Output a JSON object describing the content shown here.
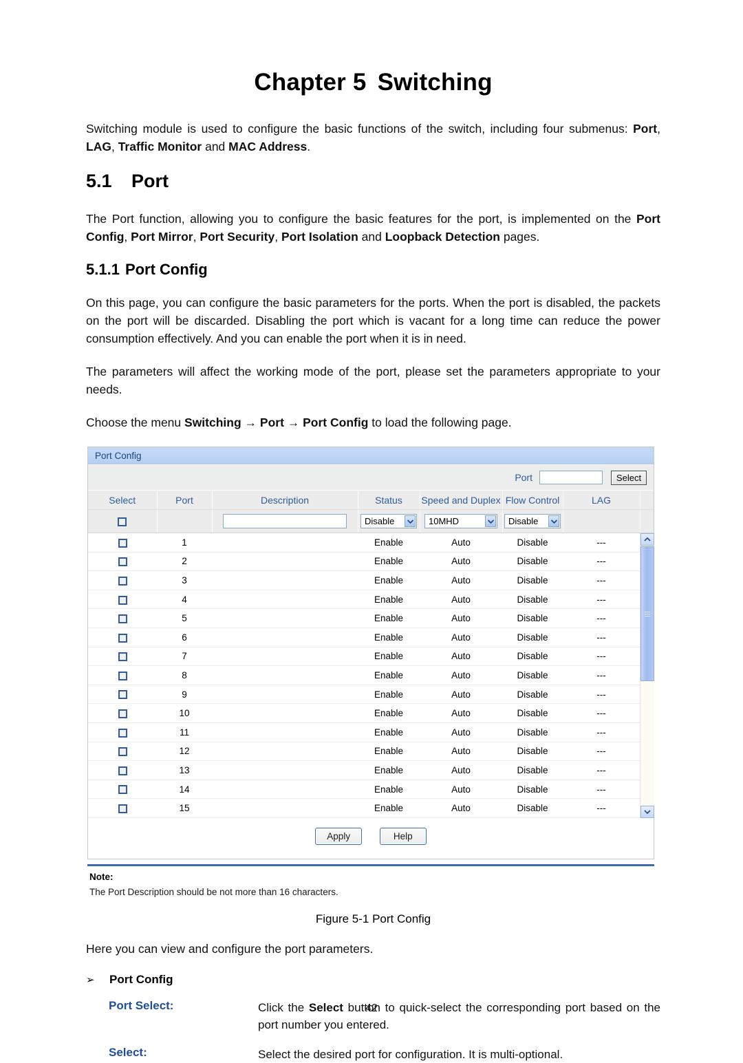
{
  "document": {
    "chapter_number": "Chapter 5",
    "chapter_title": "Switching",
    "intro_paragraph_part1": "Switching module is used to configure the basic functions of the switch, including four submenus: ",
    "intro_bold_1": "Port",
    "intro_sep_1": ", ",
    "intro_bold_2": "LAG",
    "intro_sep_2": ", ",
    "intro_bold_3": "Traffic Monitor",
    "intro_sep_3": " and ",
    "intro_bold_4": "MAC Address",
    "intro_end": ".",
    "section_number": "5.1",
    "section_title": "Port",
    "port_paragraph_part1": "The Port function, allowing you to configure the basic features for the port, is implemented on the ",
    "port_bold_1": "Port Config",
    "port_sep_1": ", ",
    "port_bold_2": "Port Mirror",
    "port_sep_2": ", ",
    "port_bold_3": "Port Security",
    "port_sep_3": ", ",
    "port_bold_4": "Port Isolation",
    "port_sep_4": " and ",
    "port_bold_5": "Loopback Detection",
    "port_end": " pages.",
    "subsection_number": "5.1.1",
    "subsection_title": "Port Config",
    "paragraph_2": "On this page, you can configure the basic parameters for the ports. When the port is disabled, the packets on the port will be discarded. Disabling the port which is vacant for a long time can reduce the power consumption effectively. And you can enable the port when it is in need.",
    "paragraph_3": "The parameters will affect the working mode of the port, please set the parameters appropriate to your needs.",
    "choose_menu_prefix": "Choose the menu ",
    "choose_menu_b1": "Switching",
    "choose_menu_arrow1": " → ",
    "choose_menu_b2": "Port",
    "choose_menu_arrow2": " → ",
    "choose_menu_b3": "Port Config",
    "choose_menu_suffix": " to load the following page.",
    "figure_caption": "Figure 5-1 Port Config",
    "after_figure_text": "Here you can view and configure the port parameters.",
    "bullet_marker": "➢",
    "bullet_heading": "Port Config",
    "page_number": "42"
  },
  "ui": {
    "panel_title": "Port Config",
    "search": {
      "label": "Port",
      "value": "",
      "placeholder": "",
      "select_button": "Select"
    },
    "table": {
      "headers": [
        "Select",
        "Port",
        "Description",
        "Status",
        "Speed and Duplex",
        "Flow Control",
        "LAG"
      ],
      "config_row": {
        "description_value": "",
        "description_placeholder": "",
        "status_value": "Disable",
        "speed_value": "10MHD",
        "flow_value": "Disable"
      },
      "rows": [
        {
          "port": "1",
          "description": "",
          "status": "Enable",
          "speed": "Auto",
          "flow": "Disable",
          "lag": "---"
        },
        {
          "port": "2",
          "description": "",
          "status": "Enable",
          "speed": "Auto",
          "flow": "Disable",
          "lag": "---"
        },
        {
          "port": "3",
          "description": "",
          "status": "Enable",
          "speed": "Auto",
          "flow": "Disable",
          "lag": "---"
        },
        {
          "port": "4",
          "description": "",
          "status": "Enable",
          "speed": "Auto",
          "flow": "Disable",
          "lag": "---"
        },
        {
          "port": "5",
          "description": "",
          "status": "Enable",
          "speed": "Auto",
          "flow": "Disable",
          "lag": "---"
        },
        {
          "port": "6",
          "description": "",
          "status": "Enable",
          "speed": "Auto",
          "flow": "Disable",
          "lag": "---"
        },
        {
          "port": "7",
          "description": "",
          "status": "Enable",
          "speed": "Auto",
          "flow": "Disable",
          "lag": "---"
        },
        {
          "port": "8",
          "description": "",
          "status": "Enable",
          "speed": "Auto",
          "flow": "Disable",
          "lag": "---"
        },
        {
          "port": "9",
          "description": "",
          "status": "Enable",
          "speed": "Auto",
          "flow": "Disable",
          "lag": "---"
        },
        {
          "port": "10",
          "description": "",
          "status": "Enable",
          "speed": "Auto",
          "flow": "Disable",
          "lag": "---"
        },
        {
          "port": "11",
          "description": "",
          "status": "Enable",
          "speed": "Auto",
          "flow": "Disable",
          "lag": "---"
        },
        {
          "port": "12",
          "description": "",
          "status": "Enable",
          "speed": "Auto",
          "flow": "Disable",
          "lag": "---"
        },
        {
          "port": "13",
          "description": "",
          "status": "Enable",
          "speed": "Auto",
          "flow": "Disable",
          "lag": "---"
        },
        {
          "port": "14",
          "description": "",
          "status": "Enable",
          "speed": "Auto",
          "flow": "Disable",
          "lag": "---"
        },
        {
          "port": "15",
          "description": "",
          "status": "Enable",
          "speed": "Auto",
          "flow": "Disable",
          "lag": "---"
        }
      ]
    },
    "actions": {
      "apply_label": "Apply",
      "help_label": "Help"
    },
    "note": {
      "title": "Note:",
      "text": "The Port Description should be not more than 16 characters."
    },
    "colors": {
      "titlebar": "#bfd6f5",
      "header_text": "#2f5b9c",
      "accent_rule": "#3f6aad",
      "scrollbar_thumb": "#9fb8ee"
    }
  },
  "definitions": [
    {
      "term": "Port Select:",
      "desc_prefix": "Click the ",
      "desc_bold": "Select",
      "desc_suffix": " button to quick-select the corresponding port based on the port number you entered."
    },
    {
      "term": "Select:",
      "desc_prefix": "Select the desired port for configuration. It is multi-optional.",
      "desc_bold": "",
      "desc_suffix": ""
    }
  ]
}
